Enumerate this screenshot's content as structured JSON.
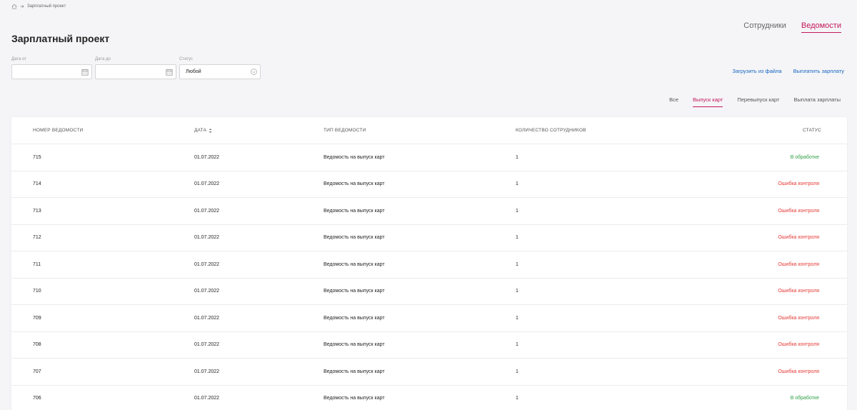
{
  "breadcrumb": {
    "current": "Зарплатный проект"
  },
  "page_title": "Зарплатный проект",
  "top_tabs": [
    {
      "label": "Сотрудники",
      "active": false
    },
    {
      "label": "Ведомости",
      "active": true
    }
  ],
  "filters": {
    "date_from": {
      "label": "Дата от",
      "value": ""
    },
    "date_to": {
      "label": "Дата до",
      "value": ""
    },
    "status": {
      "label": "Статус",
      "value": "Любой"
    }
  },
  "actions": {
    "upload": "Загрузить из файла",
    "pay": "Выплатить зарплату"
  },
  "subtabs": [
    {
      "label": "Все",
      "active": false
    },
    {
      "label": "Выпуск карт",
      "active": true
    },
    {
      "label": "Перевыпуск карт",
      "active": false
    },
    {
      "label": "Выплата зарплаты",
      "active": false
    }
  ],
  "table": {
    "columns": [
      "НОМЕР ВЕДОМОСТИ",
      "ДАТА",
      "ТИП ВЕДОМОСТИ",
      "КОЛИЧЕСТВО СОТРУДНИКОВ",
      "СТАТУС"
    ],
    "rows": [
      {
        "number": "715",
        "date": "01.07.2022",
        "type": "Ведомость на выпуск карт",
        "count": "1",
        "status": "В обработке",
        "status_kind": "ok"
      },
      {
        "number": "714",
        "date": "01.07.2022",
        "type": "Ведомость на выпуск карт",
        "count": "1",
        "status": "Ошибка контроля",
        "status_kind": "err"
      },
      {
        "number": "713",
        "date": "01.07.2022",
        "type": "Ведомость на выпуск карт",
        "count": "1",
        "status": "Ошибка контроля",
        "status_kind": "err"
      },
      {
        "number": "712",
        "date": "01.07.2022",
        "type": "Ведомость на выпуск карт",
        "count": "1",
        "status": "Ошибка контроля",
        "status_kind": "err"
      },
      {
        "number": "711",
        "date": "01.07.2022",
        "type": "Ведомость на выпуск карт",
        "count": "1",
        "status": "Ошибка контроля",
        "status_kind": "err"
      },
      {
        "number": "710",
        "date": "01.07.2022",
        "type": "Ведомость на выпуск карт",
        "count": "1",
        "status": "Ошибка контроля",
        "status_kind": "err"
      },
      {
        "number": "709",
        "date": "01.07.2022",
        "type": "Ведомость на выпуск карт",
        "count": "1",
        "status": "Ошибка контроля",
        "status_kind": "err"
      },
      {
        "number": "708",
        "date": "01.07.2022",
        "type": "Ведомость на выпуск карт",
        "count": "1",
        "status": "Ошибка контроля",
        "status_kind": "err"
      },
      {
        "number": "707",
        "date": "01.07.2022",
        "type": "Ведомость на выпуск карт",
        "count": "1",
        "status": "Ошибка контроля",
        "status_kind": "err"
      },
      {
        "number": "706",
        "date": "01.07.2022",
        "type": "Ведомость на выпуск карт",
        "count": "1",
        "status": "В обработке",
        "status_kind": "ok"
      }
    ]
  },
  "colors": {
    "accent": "#c2185b",
    "link": "#1565c0",
    "status_ok": "#2e9e44",
    "status_err": "#e53935"
  },
  "icons": [
    "home-icon",
    "arrow-right-icon",
    "calendar-icon",
    "chevron-down-icon",
    "sort-icon"
  ]
}
